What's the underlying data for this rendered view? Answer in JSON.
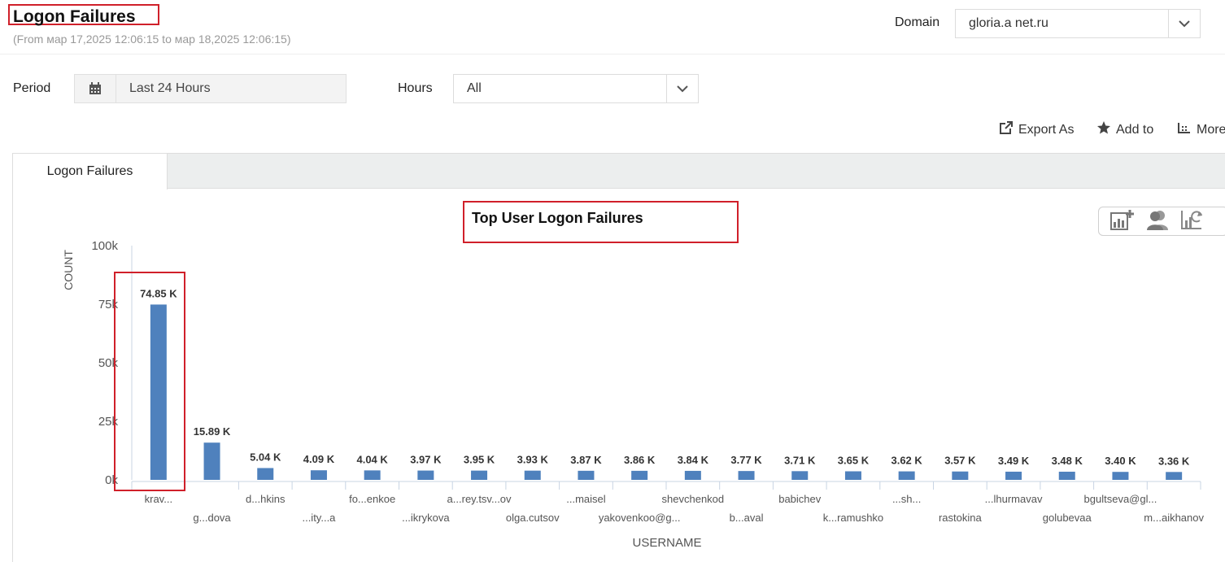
{
  "header": {
    "title": "Logon Failures",
    "subtitle": "(From мар 17,2025 12:06:15 to мар 18,2025 12:06:15)",
    "domain_label": "Domain",
    "domain_value": "gloria.a  net.ru"
  },
  "filters": {
    "period_label": "Period",
    "period_value": "Last 24 Hours",
    "hours_label": "Hours",
    "hours_value": "All"
  },
  "actions": {
    "export": "Export As",
    "add_to": "Add to",
    "more": "More"
  },
  "tabs": [
    {
      "label": "Logon Failures",
      "active": true
    }
  ],
  "icons": [
    "calendar-icon",
    "chevron-down-icon",
    "export-icon",
    "star-icon",
    "more-icon",
    "add-chart-icon",
    "users-icon",
    "chart-refresh-icon"
  ],
  "colors": {
    "bar": "#4f81bd",
    "highlight": "#d0202a"
  },
  "chart_data": {
    "type": "bar",
    "title": "Top User Logon Failures",
    "xlabel": "USERNAME",
    "ylabel": "COUNT",
    "ylim": [
      0,
      100000
    ],
    "yticks": [
      "0k",
      "25k",
      "50k",
      "75k",
      "100k"
    ],
    "categories": [
      "krav...",
      "g...dova",
      "d...hkins",
      "...ity...a",
      "fo...enkoe",
      "...ikrykova",
      "a...rey.tsv...ov",
      "olga.cutsov",
      "...maisel",
      "yakovenkoo@g...",
      "shevchenkod",
      "b...aval",
      "babichev",
      "k...ramushko",
      "...sh...",
      "rastokina",
      "...lhurmavav",
      "golubevaa",
      "bgultseva@gl...",
      "m...aikhanov"
    ],
    "values": [
      74850,
      15890,
      5040,
      4090,
      4040,
      3970,
      3950,
      3930,
      3870,
      3860,
      3840,
      3770,
      3710,
      3650,
      3620,
      3570,
      3490,
      3480,
      3400,
      3360
    ],
    "data_labels": [
      "74.85 K",
      "15.89 K",
      "5.04 K",
      "4.09 K",
      "4.04 K",
      "3.97 K",
      "3.95 K",
      "3.93 K",
      "3.87 K",
      "3.86 K",
      "3.84 K",
      "3.77 K",
      "3.71 K",
      "3.65 K",
      "3.62 K",
      "3.57 K",
      "3.49 K",
      "3.48 K",
      "3.40 K",
      "3.36 K"
    ]
  }
}
